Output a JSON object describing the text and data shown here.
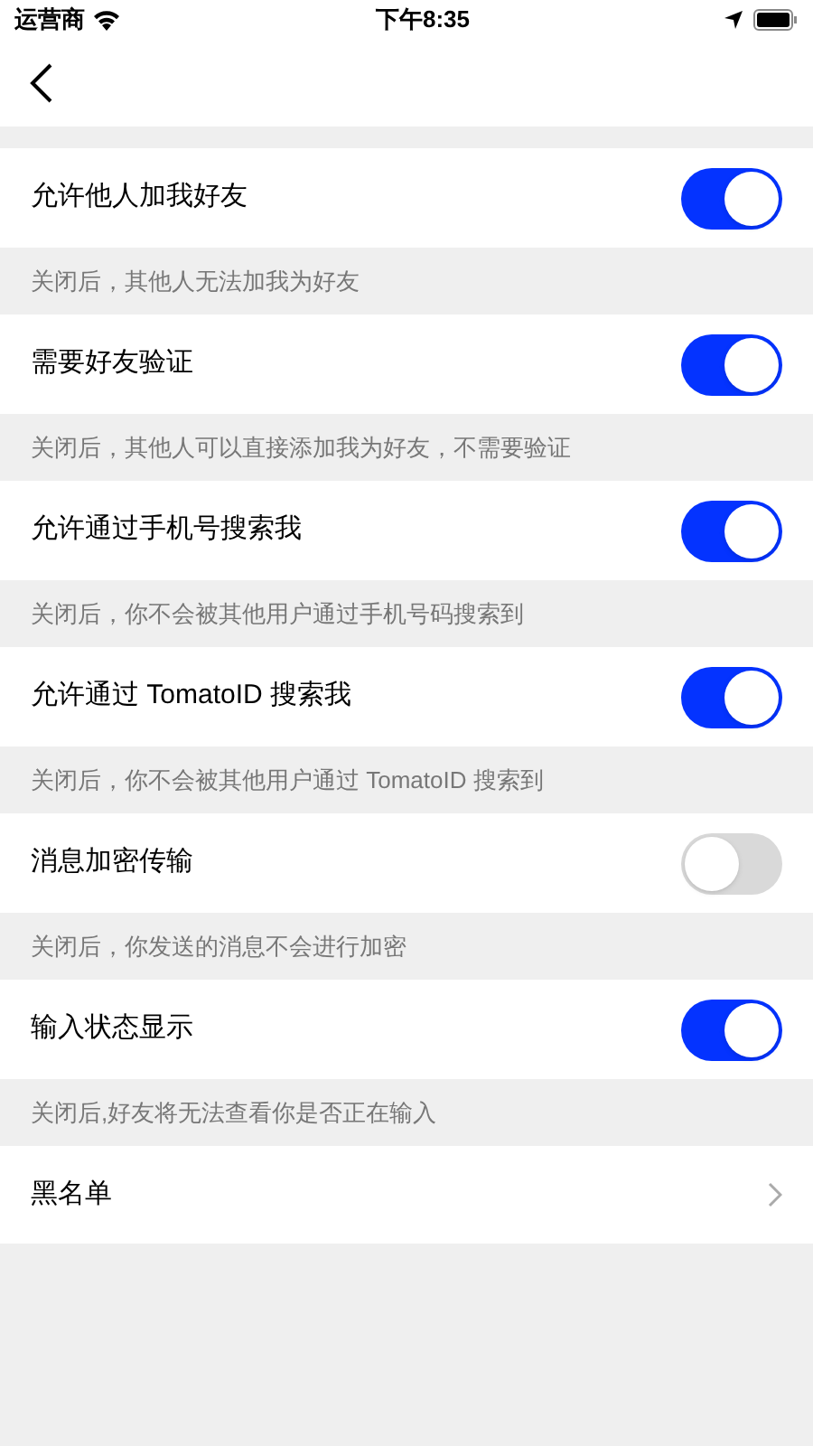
{
  "status_bar": {
    "carrier": "运营商",
    "time": "下午8:35"
  },
  "settings": [
    {
      "label": "允许他人加我好友",
      "on": true,
      "description": "关闭后，其他人无法加我为好友"
    },
    {
      "label": "需要好友验证",
      "on": true,
      "description": "关闭后，其他人可以直接添加我为好友，不需要验证"
    },
    {
      "label": "允许通过手机号搜索我",
      "on": true,
      "description": "关闭后，你不会被其他用户通过手机号码搜索到"
    },
    {
      "label": "允许通过 TomatoID 搜索我",
      "on": true,
      "description": "关闭后，你不会被其他用户通过 TomatoID 搜索到"
    },
    {
      "label": "消息加密传输",
      "on": false,
      "description": "关闭后，你发送的消息不会进行加密"
    },
    {
      "label": "输入状态显示",
      "on": true,
      "description": "关闭后,好友将无法查看你是否正在输入"
    }
  ],
  "blacklist": {
    "label": "黑名单"
  }
}
